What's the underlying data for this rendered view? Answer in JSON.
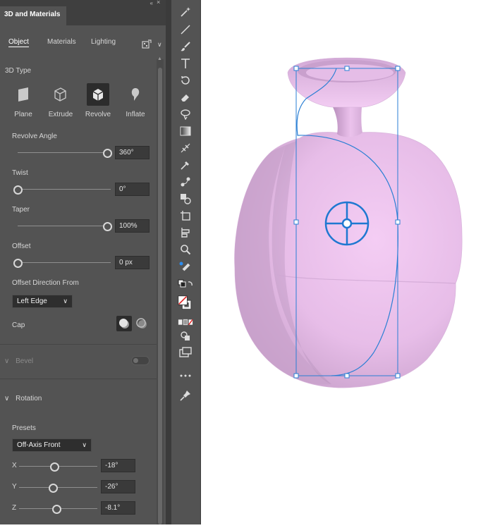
{
  "panel": {
    "title": "3D and Materials",
    "tabs": [
      {
        "label": "Object",
        "active": true
      },
      {
        "label": "Materials",
        "active": false
      },
      {
        "label": "Lighting",
        "active": false
      }
    ],
    "type_section": {
      "label": "3D Type",
      "types": [
        {
          "label": "Plane",
          "icon": "plane-icon",
          "selected": false
        },
        {
          "label": "Extrude",
          "icon": "extrude-icon",
          "selected": false
        },
        {
          "label": "Revolve",
          "icon": "revolve-icon",
          "selected": true
        },
        {
          "label": "Inflate",
          "icon": "inflate-icon",
          "selected": false
        }
      ]
    },
    "revolve_angle": {
      "label": "Revolve Angle",
      "value": "360°",
      "level": 1.0
    },
    "twist": {
      "label": "Twist",
      "value": "0°",
      "level": 0.0
    },
    "taper": {
      "label": "Taper",
      "value": "100%",
      "level": 1.0
    },
    "offset": {
      "label": "Offset",
      "value": "0 px",
      "level": 0.0
    },
    "offset_direction": {
      "label": "Offset Direction From",
      "value": "Left Edge"
    },
    "cap": {
      "label": "Cap"
    },
    "bevel": {
      "label": "Bevel",
      "enabled": false
    },
    "rotation": {
      "label": "Rotation",
      "presets_label": "Presets",
      "preset": "Off-Axis Front",
      "axes": [
        {
          "axis": "X",
          "value": "-18°",
          "level": 0.45
        },
        {
          "axis": "Y",
          "value": "-26°",
          "level": 0.43
        },
        {
          "axis": "Z",
          "value": "-8.1°",
          "level": 0.48
        }
      ]
    }
  },
  "toolbar": {
    "tools": [
      "magic-wand-icon",
      "line-icon",
      "paintbrush-icon",
      "type-icon",
      "rotate-icon",
      "eraser-icon",
      "lasso-icon",
      "gradient-icon",
      "width-icon",
      "eyedropper-icon",
      "blend-icon",
      "shape-builder-icon",
      "artboard-icon",
      "slice-icon",
      "zoom-icon",
      "color-picker-icon",
      "swap-icon",
      "fill-stroke-icon",
      "color-mode-icon",
      "draw-mode-icon",
      "screen-mode-icon",
      "more-icon",
      "pin-icon"
    ]
  },
  "colors": {
    "accent": "#2a7fd4",
    "object": "#f0c8f0"
  }
}
